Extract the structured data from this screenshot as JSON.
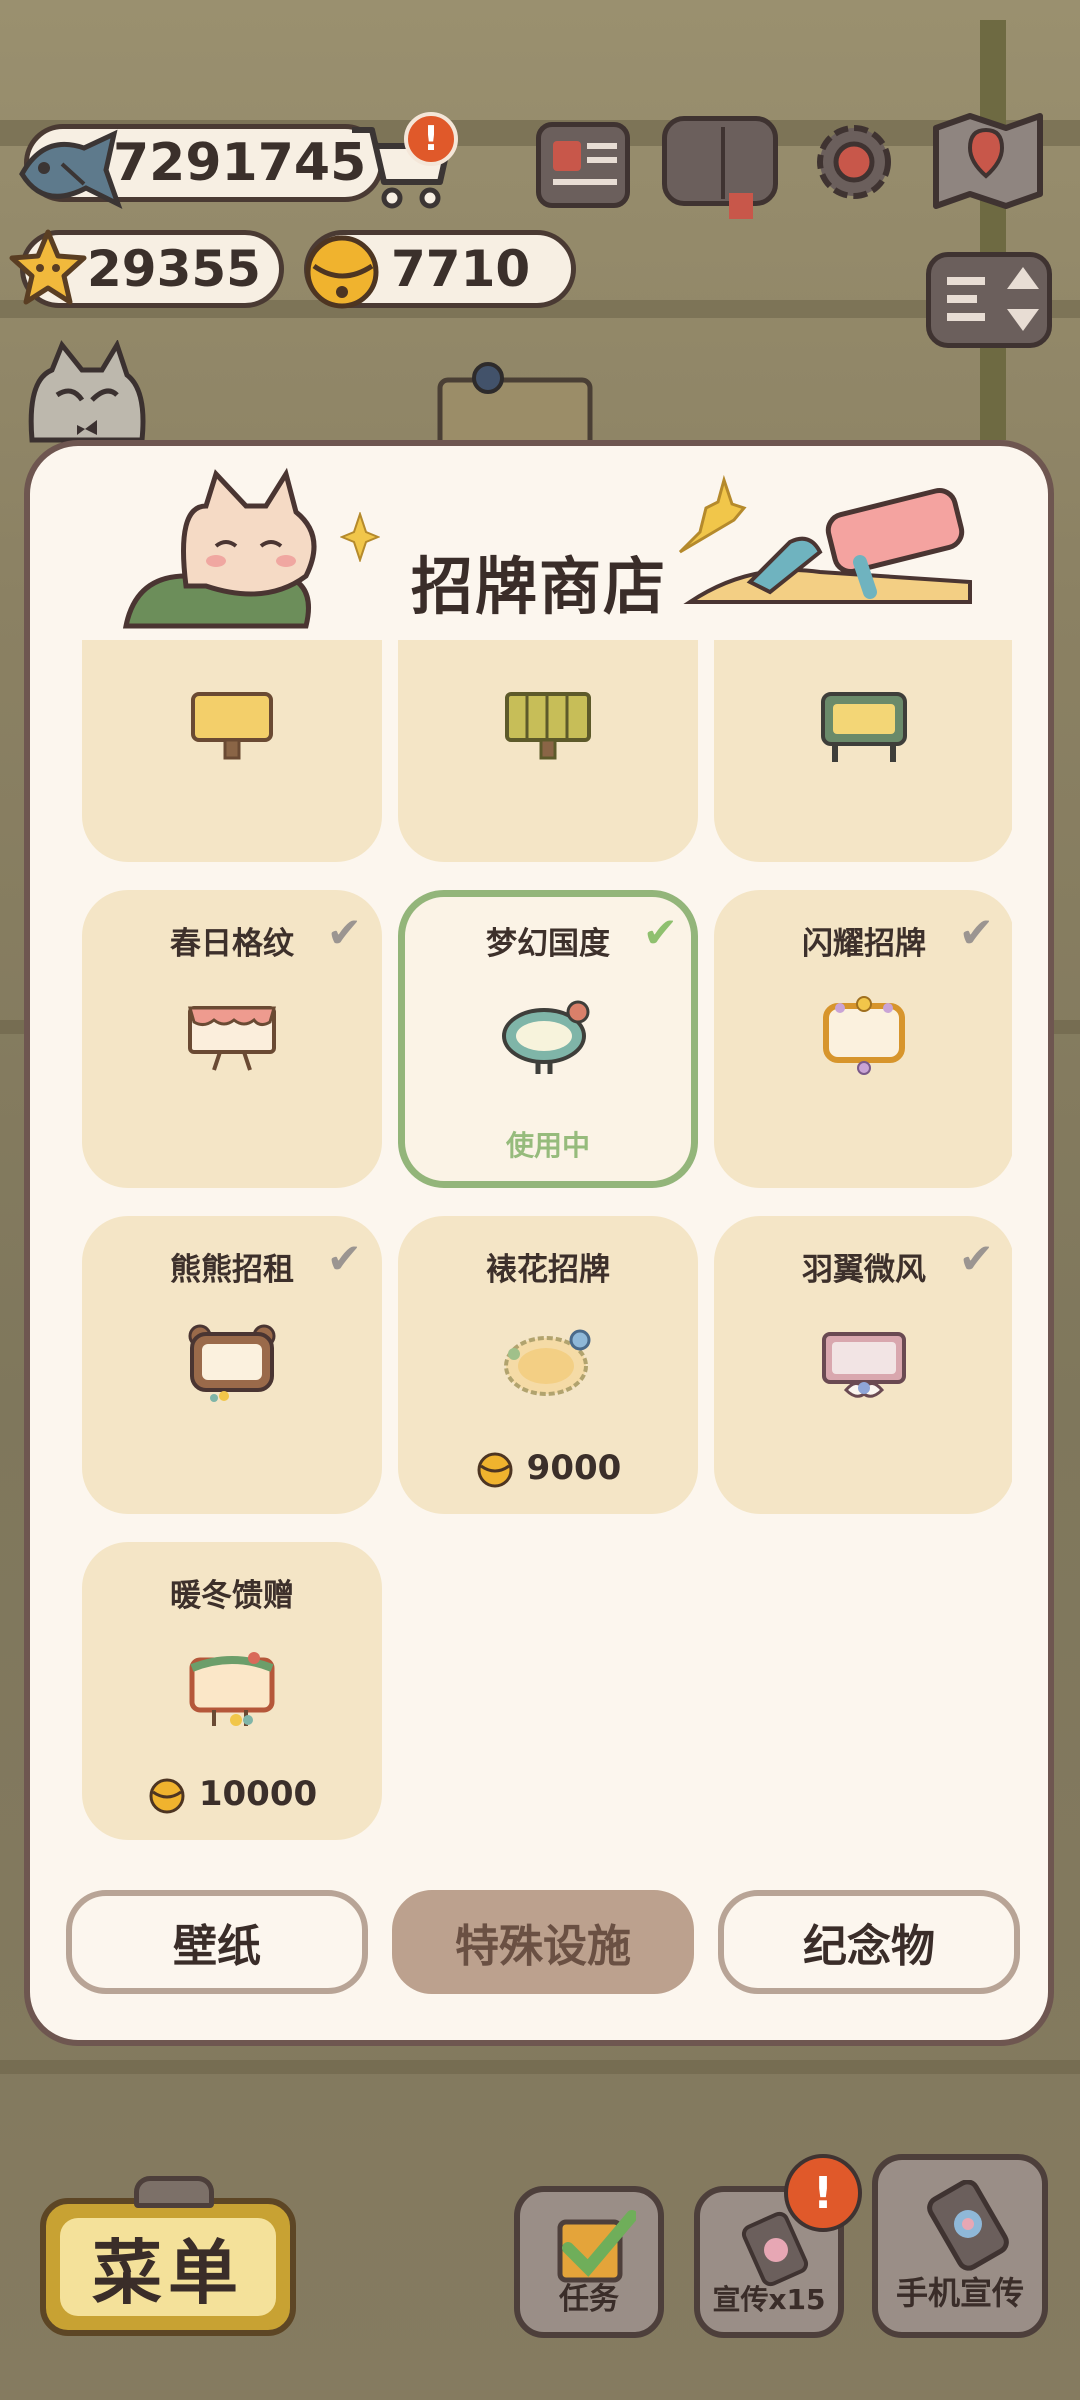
{
  "hud": {
    "fish_count": "7291745",
    "star_count": "29355",
    "bell_count": "7710",
    "cart_badge": "!",
    "icons": [
      "newspaper-icon",
      "album-icon",
      "settings-gear-icon",
      "map-icon",
      "sort-toggle-icon"
    ]
  },
  "shop": {
    "title": "招牌商店",
    "items": [
      {
        "name": "",
        "owned": true,
        "status": "",
        "price": ""
      },
      {
        "name": "",
        "owned": true,
        "status": "",
        "price": ""
      },
      {
        "name": "",
        "owned": true,
        "status": "",
        "price": ""
      },
      {
        "name": "春日格纹",
        "owned": true,
        "status": "",
        "price": ""
      },
      {
        "name": "梦幻国度",
        "owned": true,
        "status": "使用中",
        "price": ""
      },
      {
        "name": "闪耀招牌",
        "owned": true,
        "status": "",
        "price": ""
      },
      {
        "name": "熊熊招租",
        "owned": true,
        "status": "",
        "price": ""
      },
      {
        "name": "裱花招牌",
        "owned": false,
        "status": "",
        "price": "9000"
      },
      {
        "name": "羽翼微风",
        "owned": true,
        "status": "",
        "price": ""
      },
      {
        "name": "暖冬馈赠",
        "owned": false,
        "status": "",
        "price": "10000"
      }
    ],
    "check_glyph": "✔",
    "tabs": [
      "壁纸",
      "特殊设施",
      "纪念物"
    ],
    "selected_tab": "特殊设施"
  },
  "bottom": {
    "menu_label": "菜单",
    "tasks_label": "任务",
    "promo_label": "宣传x15",
    "phone_promo_label": "手机宣传",
    "promo_badge": "!"
  },
  "colors": {
    "panel_bg": "#fcf6ee",
    "card_bg": "#f4e5c6",
    "active_border": "#93b57a",
    "selected_tab": "#bca18e",
    "badge": "#e0592a"
  }
}
